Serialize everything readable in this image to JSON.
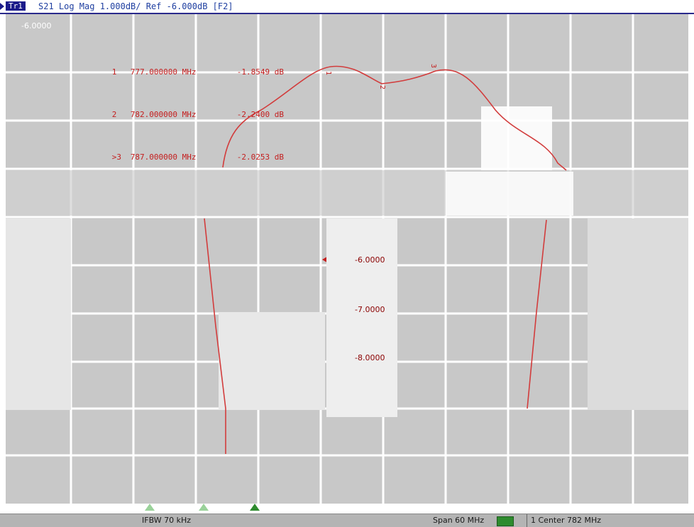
{
  "trace": {
    "badge": "Tr1",
    "title": "S21 Log Mag 1.000dB/ Ref -6.000dB [F2]"
  },
  "scale": {
    "top_label": "-6.0000",
    "mid_labels": [
      "-6.0000",
      "-7.0000",
      "-8.0000"
    ]
  },
  "markers": [
    {
      "num": "1",
      "freq": "777.000000 MHz",
      "value": "-1.8549 dB"
    },
    {
      "num": "2",
      "freq": "782.000000 MHz",
      "value": "-2.2400 dB"
    },
    {
      "num": ">3",
      "freq": "787.000000 MHz",
      "value": "-2.0253 dB"
    }
  ],
  "status": {
    "ifbw": "IFBW 70 kHz",
    "span": "Span 60 MHz",
    "center": "1  Center 782 MHz"
  },
  "colors": {
    "trace": "#d23c3c",
    "grid": "#ffffff",
    "background": "#c8c8c8",
    "marker_active": "#2e8b2e"
  }
}
